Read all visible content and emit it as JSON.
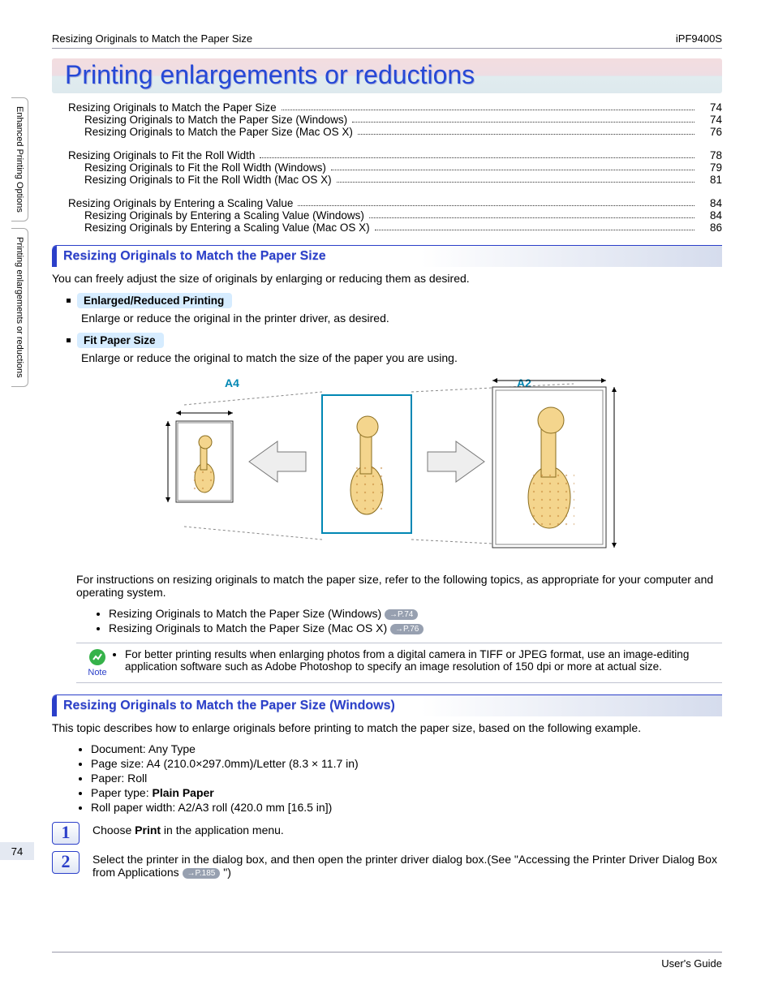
{
  "header": {
    "left": "Resizing Originals to Match the Paper Size",
    "right": "iPF9400S"
  },
  "sidetabs": {
    "top": "Enhanced Printing Options",
    "bottom": "Printing enlargements or reductions"
  },
  "title": "Printing enlargements or reductions",
  "toc": [
    {
      "label": "Resizing Originals to Match the Paper Size",
      "page": "74",
      "sub": false
    },
    {
      "label": "Resizing Originals to Match the Paper Size (Windows)",
      "page": "74",
      "sub": true
    },
    {
      "label": "Resizing Originals to Match the Paper Size (Mac OS X)",
      "page": "76",
      "sub": true
    },
    {
      "label": "Resizing Originals to Fit the Roll Width",
      "page": "78",
      "sub": false
    },
    {
      "label": "Resizing Originals to Fit the Roll Width (Windows)",
      "page": "79",
      "sub": true
    },
    {
      "label": "Resizing Originals to Fit the Roll Width (Mac OS X)",
      "page": "81",
      "sub": true
    },
    {
      "label": "Resizing Originals by Entering a Scaling Value",
      "page": "84",
      "sub": false
    },
    {
      "label": "Resizing Originals by Entering a Scaling Value (Windows)",
      "page": "84",
      "sub": true
    },
    {
      "label": "Resizing Originals by Entering a Scaling Value (Mac OS X)",
      "page": "86",
      "sub": true
    }
  ],
  "section1": {
    "title": "Resizing Originals to Match the Paper Size",
    "intro": "You can freely adjust the size of originals by enlarging or reducing them as desired.",
    "b1_label": "Enlarged/Reduced Printing",
    "b1_text": "Enlarge or reduce the original in the printer driver, as desired.",
    "b2_label": "Fit Paper Size",
    "b2_text": "Enlarge or reduce the original to match the size of the paper you are using.",
    "diagram_labels": {
      "left": "A4",
      "right": "A2"
    },
    "after_diagram": "For instructions on resizing originals to match the paper size, refer to the following topics, as appropriate for your computer and operating system.",
    "links": [
      {
        "text": "Resizing Originals to Match the Paper Size (Windows)",
        "ref": "→P.74"
      },
      {
        "text": "Resizing Originals to Match the Paper Size (Mac OS X)",
        "ref": "→P.76"
      }
    ],
    "note_label": "Note",
    "note_text": "For better printing results when enlarging photos from a digital camera in TIFF or JPEG format, use an image-editing application software such as Adobe Photoshop to specify an image resolution of 150 dpi or more at actual size."
  },
  "section2": {
    "title": "Resizing Originals to Match the Paper Size (Windows)",
    "intro": "This topic describes how to enlarge originals before printing to match the paper size, based on the following example.",
    "bullets": [
      "Document: Any Type",
      "Page size: A4 (210.0×297.0mm)/Letter (8.3 × 11.7 in)",
      "Paper: Roll",
      {
        "prefix": "Paper type: ",
        "bold": "Plain Paper"
      },
      "Roll paper width: A2/A3 roll (420.0 mm [16.5 in])"
    ],
    "steps": [
      {
        "n": "1",
        "prefix": "Choose ",
        "bold": "Print",
        "suffix": " in the application menu."
      },
      {
        "n": "2",
        "text": "Select the printer in the dialog box, and then open the printer driver dialog box.(See \"Accessing the Printer Driver Dialog Box from Applications ",
        "ref": "→P.185",
        "tail": " \")"
      }
    ]
  },
  "page_badge": "74",
  "footer_right": "User's Guide"
}
